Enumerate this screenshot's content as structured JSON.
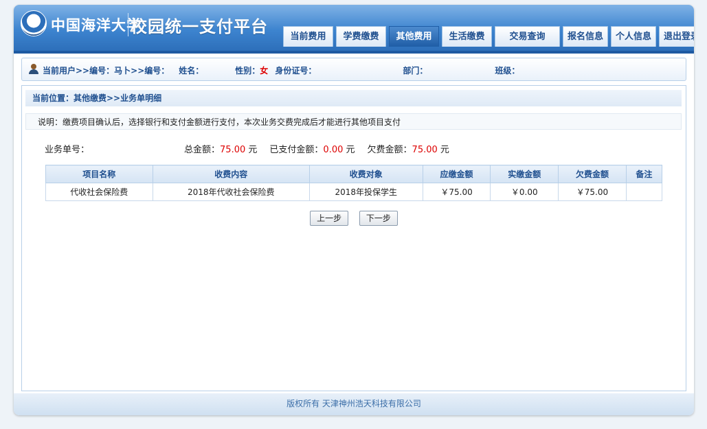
{
  "header": {
    "university_name": "中国海洋大学",
    "platform_title": "校园统一支付平台",
    "tabs": [
      {
        "label": "当前费用",
        "active": false
      },
      {
        "label": "学费缴费",
        "active": false
      },
      {
        "label": "其他费用",
        "active": true
      },
      {
        "label": "生活缴费",
        "active": false
      },
      {
        "label": "交易查询",
        "active": false
      },
      {
        "label": "报名信息",
        "active": false
      },
      {
        "label": "个人信息",
        "active": false
      },
      {
        "label": "退出登录",
        "active": false
      }
    ]
  },
  "userbar": {
    "current_user": "当前用户>>编号：",
    "code_mask": "马卜",
    "number_label": ">>编号：",
    "name_label": "姓名：",
    "gender_label": "性别：",
    "gender_value": "女",
    "id_label": "身份证号：",
    "dept_label": "部门：",
    "class_label": "班级："
  },
  "breadcrumb": "当前位置：其他缴费>>业务单明细",
  "notice": "说明：缴费项目确认后，选择银行和支付金额进行支付，本次业务交费完成后才能进行其他项目支付",
  "summary": {
    "order_label": "业务单号：",
    "total_label": "总金额：",
    "total_value": "75.00",
    "paid_label": "已支付金额：",
    "paid_value": "0.00",
    "owed_label": "欠费金额：",
    "owed_value": "75.00",
    "unit": "元"
  },
  "table": {
    "headers": [
      "项目名称",
      "收费内容",
      "收费对象",
      "应缴金额",
      "实缴金额",
      "欠费金额",
      "备注"
    ],
    "rows": [
      [
        "代收社会保险费",
        "2018年代收社会保险费",
        "2018年投保学生",
        "￥75.00",
        "￥0.00",
        "￥75.00",
        ""
      ]
    ]
  },
  "buttons": {
    "prev": "上一步",
    "next": "下一步"
  },
  "footer": "版权所有 天津神州浩天科技有限公司",
  "colors": {
    "brand_blue": "#2d6fba",
    "accent_red": "#dd0000"
  }
}
